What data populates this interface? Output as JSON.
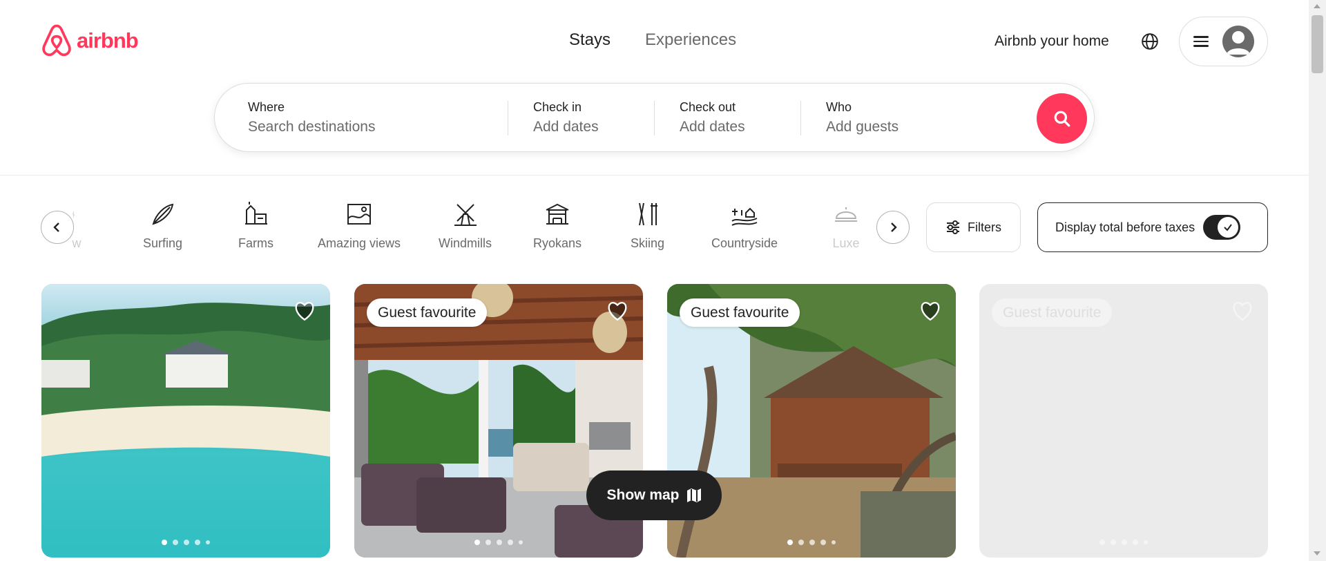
{
  "brand": {
    "name": "airbnb",
    "color": "#ff385c"
  },
  "nav": {
    "stays": "Stays",
    "experiences": "Experiences"
  },
  "header_right": {
    "host_link": "Airbnb your home",
    "globe_icon": "globe-icon",
    "menu_icon": "hamburger-icon",
    "avatar_icon": "user-avatar-icon"
  },
  "search": {
    "where": {
      "label": "Where",
      "placeholder": "Search destinations"
    },
    "check_in": {
      "label": "Check in",
      "placeholder": "Add dates"
    },
    "check_out": {
      "label": "Check out",
      "placeholder": "Add dates"
    },
    "who": {
      "label": "Who",
      "placeholder": "Add guests"
    },
    "button_icon": "search-icon"
  },
  "categories": {
    "partial_left": "w",
    "items": [
      "Surfing",
      "Farms",
      "Amazing views",
      "Windmills",
      "Ryokans",
      "Skiing",
      "Countryside",
      "Luxe"
    ]
  },
  "filters": {
    "label": "Filters"
  },
  "taxes_toggle": {
    "label": "Display total before taxes",
    "checked": true
  },
  "listings": [
    {
      "badge": "",
      "image": "aerial-tropical-island-villa"
    },
    {
      "badge": "Guest favourite",
      "image": "covered-patio-wicker-furniture-sea-view"
    },
    {
      "badge": "Guest favourite",
      "image": "wooden-treehouse-palm-trees"
    },
    {
      "badge": "Guest favourite",
      "image": "loading-placeholder"
    }
  ],
  "show_map": {
    "label": "Show map"
  }
}
